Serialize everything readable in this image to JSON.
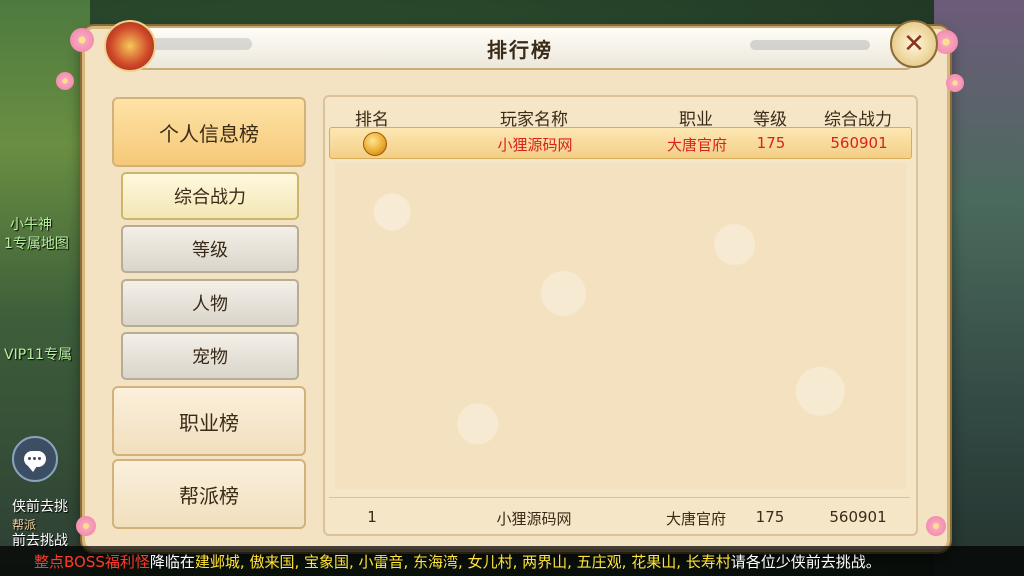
{
  "window": {
    "title": "排行榜"
  },
  "background_texts": [
    "小牛神",
    "1专属地图",
    "VIP11专属",
    "侠前去挑",
    "帮派",
    "前去挑战"
  ],
  "sidebar": {
    "sections": [
      {
        "label": "个人信息榜",
        "active": true
      },
      {
        "label": "职业榜",
        "active": false
      },
      {
        "label": "帮派榜",
        "active": false
      }
    ],
    "sub_items": [
      {
        "label": "综合战力",
        "active": true
      },
      {
        "label": "等级",
        "active": false
      },
      {
        "label": "人物",
        "active": false
      },
      {
        "label": "宠物",
        "active": false
      }
    ]
  },
  "table": {
    "headers": [
      "排名",
      "玩家名称",
      "职业",
      "等级",
      "综合战力"
    ],
    "rows": [
      {
        "rank_icon": "gold-medal-icon",
        "name": "小狸源码网",
        "class": "大唐官府",
        "level": "175",
        "power": "560901"
      }
    ],
    "my_row": {
      "rank": "1",
      "name": "小狸源码网",
      "class": "大唐官府",
      "level": "175",
      "power": "560901"
    }
  },
  "marquee": {
    "part1": "整点BOSS福利怪",
    "part2": "降临在",
    "part3": "建邺城, 傲来国, 宝象国, 小雷音, 东海湾, 女儿村, 两界山, 五庄观, 花果山, 长寿村",
    "part4": "请各位少侠前去挑战。"
  },
  "colors": {
    "highlight_text": "#d8221f",
    "panel_bg": "#f3e3c3",
    "marquee_red": "#ff3a2a",
    "marquee_yellow": "#ffe23a"
  }
}
